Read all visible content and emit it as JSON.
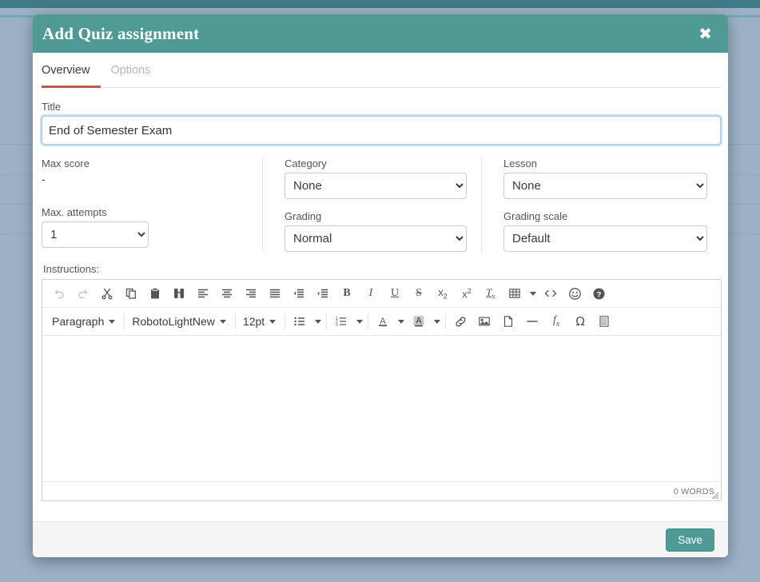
{
  "colors": {
    "modal_header": "#4f9a94",
    "accent_tab_underline": "#b75a52",
    "save_button": "#4f9a94",
    "backdrop": "#9cb1c6",
    "top_strip": "#3e7b86",
    "focus_ring": "#a6cbe8"
  },
  "modal": {
    "title": "Add Quiz assignment",
    "close_icon": "close-icon",
    "close_glyph": "✖"
  },
  "tabs": [
    {
      "label": "Overview",
      "active": true
    },
    {
      "label": "Options",
      "active": false
    }
  ],
  "form": {
    "title_label": "Title",
    "title_value": "End of Semester Exam",
    "title_placeholder": "",
    "max_score_label": "Max score",
    "max_score_value": "-",
    "max_attempts_label": "Max. attempts",
    "max_attempts_value": "1",
    "category_label": "Category",
    "category_value": "None",
    "grading_label": "Grading",
    "grading_value": "Normal",
    "lesson_label": "Lesson",
    "lesson_value": "None",
    "grading_scale_label": "Grading scale",
    "grading_scale_value": "Default",
    "instructions_label": "Instructions:"
  },
  "editor": {
    "paragraph_format": "Paragraph",
    "font_family": "RobotoLightNew",
    "font_size": "12pt",
    "content": "",
    "word_count": "0 WORDS",
    "toolbar_row1": [
      "undo-icon",
      "redo-icon",
      "cut-icon",
      "copy-icon",
      "paste-icon",
      "find-replace-icon",
      "align-left-icon",
      "align-center-icon",
      "align-right-icon",
      "align-justify-icon",
      "outdent-icon",
      "indent-icon",
      "bold-icon",
      "italic-icon",
      "underline-icon",
      "strikethrough-icon",
      "subscript-icon",
      "superscript-icon",
      "clear-formatting-icon",
      "table-icon",
      "source-code-icon",
      "emoji-icon",
      "help-icon"
    ],
    "toolbar_row2": [
      "bullet-list-icon",
      "numbered-list-icon",
      "text-color-icon",
      "highlight-color-icon",
      "link-icon",
      "image-icon",
      "file-icon",
      "horizontal-rule-icon",
      "math-formula-icon",
      "special-character-icon",
      "page-break-icon"
    ]
  },
  "footer": {
    "save_label": "Save"
  }
}
